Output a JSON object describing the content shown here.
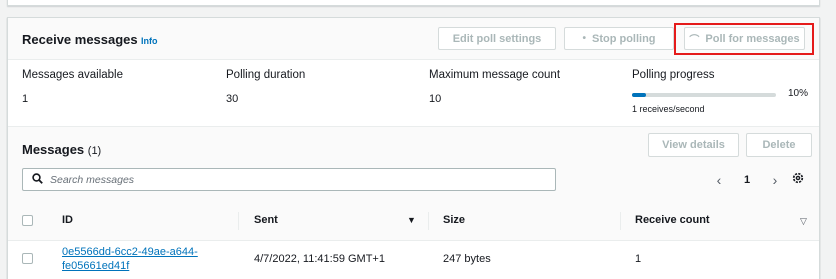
{
  "header": {
    "title": "Receive messages",
    "info": "Info",
    "edit_btn": "Edit poll settings",
    "stop_btn": "Stop polling",
    "poll_btn": "Poll for messages",
    "edit_icon": "none",
    "stop_icon": "small-dot-icon",
    "poll_icon": "refresh-arc-icon"
  },
  "stats": {
    "available_label": "Messages available",
    "available_value": "1",
    "duration_label": "Polling duration",
    "duration_value": "30",
    "max_label": "Maximum message count",
    "max_value": "10",
    "progress_label": "Polling progress",
    "progress_fraction": 0.1,
    "progress_pct_text": "10%",
    "progress_rate": "1 receives/second"
  },
  "messages": {
    "title": "Messages",
    "count": "(1)",
    "view_btn": "View details",
    "delete_btn": "Delete",
    "search_placeholder": "Search messages",
    "page": "1",
    "columns": {
      "id": "ID",
      "sent": "Sent",
      "size": "Size",
      "receive_count": "Receive count"
    },
    "rows": [
      {
        "id_line1": "0e5566dd-6cc2-49ae-a644-",
        "id_line2": "fe05661ed41f",
        "sent": "4/7/2022, 11:41:59 GMT+1",
        "size": "247 bytes",
        "receive_count": "1"
      }
    ]
  },
  "colors": {
    "accent": "#0073bb",
    "highlight": "#e51b1b",
    "disabled_text": "#aab7b8"
  }
}
